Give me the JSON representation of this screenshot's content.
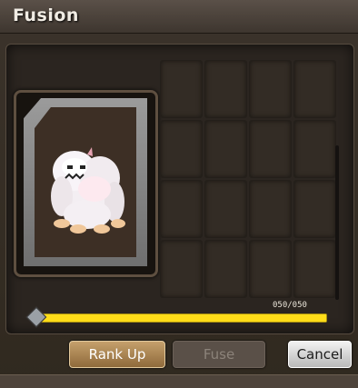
{
  "window": {
    "title": "Fusion"
  },
  "slider": {
    "counter_text": "050/050",
    "fill_fraction": 1.0
  },
  "buttons": {
    "rank_up": "Rank Up",
    "fuse": "Fuse",
    "cancel": "Cancel"
  },
  "grid": {
    "rows": 4,
    "cols": 4
  },
  "card": {
    "icon": "yeti-monster-icon"
  },
  "colors": {
    "slider_bar": "#ffe025",
    "rank_up_button": "#c5a06c",
    "cancel_button": "#e6e6e6",
    "fuse_disabled": "#5a5048"
  }
}
